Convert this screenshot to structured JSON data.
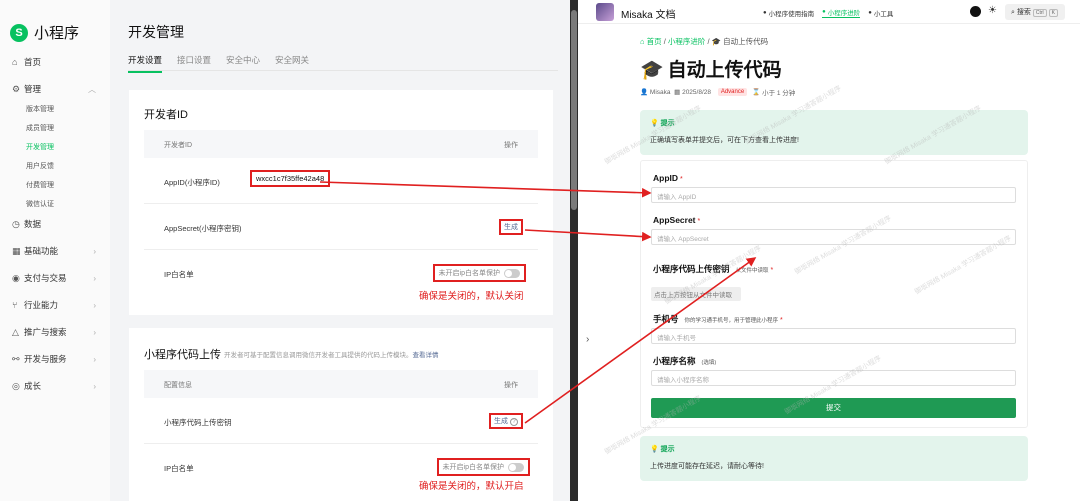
{
  "left": {
    "app_name": "小程序",
    "nav": [
      {
        "label": "首页",
        "icon": "home-icon"
      },
      {
        "label": "管理",
        "icon": "gear-icon"
      },
      {
        "label": "数据",
        "icon": "clock-icon"
      },
      {
        "label": "基础功能",
        "icon": "grid-icon"
      },
      {
        "label": "支付与交易",
        "icon": "coin-icon"
      },
      {
        "label": "行业能力",
        "icon": "branch-icon"
      },
      {
        "label": "推广与搜索",
        "icon": "megaphone-icon"
      },
      {
        "label": "开发与服务",
        "icon": "share-icon"
      },
      {
        "label": "成长",
        "icon": "layers-icon"
      }
    ],
    "sub_items": [
      "版本管理",
      "成员管理",
      "开发管理",
      "用户反馈",
      "付费管理",
      "微信认证"
    ],
    "page_title": "开发管理",
    "tabs": [
      "开发设置",
      "接口设置",
      "安全中心",
      "安全网关"
    ],
    "card1": {
      "title": "开发者ID",
      "col1": "开发者ID",
      "col2": "操作",
      "rows": [
        {
          "label": "AppID(小程序ID)",
          "value": "wxcc1c7f35ffe42a48"
        },
        {
          "label": "AppSecret(小程序密钥)",
          "action": "生成"
        },
        {
          "label": "IP白名单",
          "toggle": "未开启ip白名单保护"
        }
      ],
      "note": "确保是关闭的，默认关闭"
    },
    "card2": {
      "title": "小程序代码上传",
      "subtitle": "开发者可基于配置信息调用微信开发者工具提供的代码上传模块。",
      "link": "查看详情",
      "col1": "配置信息",
      "col2": "操作",
      "rows": [
        {
          "label": "小程序代码上传密钥",
          "action": "生成"
        },
        {
          "label": "IP白名单",
          "toggle": "未开启ip白名单保护"
        }
      ],
      "note": "确保是关闭的，默认开启"
    }
  },
  "right": {
    "site_title": "Misaka 文档",
    "topnav": [
      "小程序使用指南",
      "小程序进阶",
      "小工具"
    ],
    "search_label": "搜索",
    "kbd": [
      "Ctrl",
      "K"
    ],
    "breadcrumb": [
      "首页",
      "小程序进阶",
      "自动上传代码"
    ],
    "doc_title": "自动上传代码",
    "meta": {
      "author": "Misaka",
      "date": "2025/8/28",
      "badge": "Advance",
      "read": "小于 1 分钟"
    },
    "tip1": {
      "head": "提示",
      "body": "正确填写表单并提交后，可在下方查看上传进度!"
    },
    "form": {
      "appid_label": "AppID",
      "appid_placeholder": "请输入 AppID",
      "secret_label": "AppSecret",
      "secret_placeholder": "请输入 AppSecret",
      "key_label": "小程序代码上传密钥",
      "key_hint": "从文件中读取",
      "key_button": "点击上方按钮从文件中读取",
      "phone_label": "手机号",
      "phone_hint": "你的学习通手机号，用于管理此小程序",
      "phone_placeholder": "请输入手机号",
      "name_label": "小程序名称",
      "name_hint": "(选填)",
      "name_placeholder": "请输入小程序名称",
      "submit": "提交"
    },
    "tip2": {
      "head": "提示",
      "body": "上传进度可能存在延迟，请耐心等待!"
    },
    "watermark": "御坂网络 Misaka 学习通答题小程序"
  },
  "colors": {
    "accent": "#07c160",
    "annotation": "#e02020",
    "tip_bg": "#e3f4ec",
    "submit": "#1f9a54"
  }
}
